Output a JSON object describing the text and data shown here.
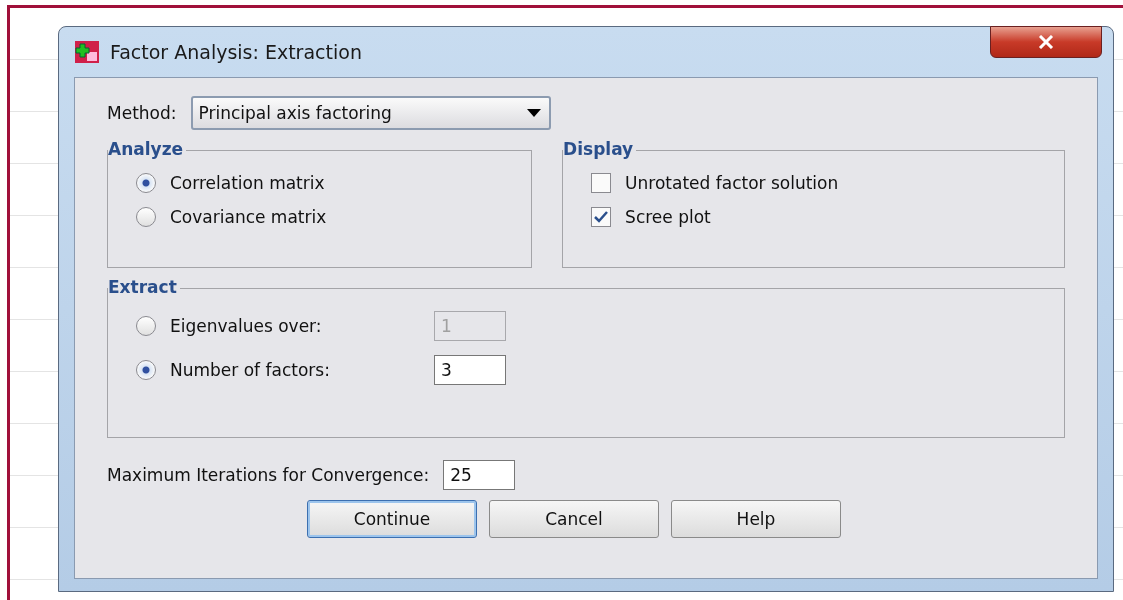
{
  "window": {
    "title": "Factor Analysis: Extraction"
  },
  "method": {
    "label": "Method:",
    "value": "Principal axis factoring"
  },
  "analyze": {
    "title": "Analyze",
    "options": [
      {
        "label": "Correlation matrix",
        "selected": true
      },
      {
        "label": "Covariance matrix",
        "selected": false
      }
    ]
  },
  "display": {
    "title": "Display",
    "options": [
      {
        "label": "Unrotated factor solution",
        "checked": false
      },
      {
        "label": "Scree plot",
        "checked": true
      }
    ]
  },
  "extract": {
    "title": "Extract",
    "options": [
      {
        "label": "Eigenvalues over:",
        "selected": false,
        "value": "1",
        "disabled": true
      },
      {
        "label": "Number of factors:",
        "selected": true,
        "value": "3",
        "disabled": false
      }
    ]
  },
  "iterations": {
    "label": "Maximum Iterations for Convergence:",
    "value": "25"
  },
  "buttons": [
    {
      "label": "Continue",
      "default": true
    },
    {
      "label": "Cancel",
      "default": false
    },
    {
      "label": "Help",
      "default": false
    }
  ]
}
